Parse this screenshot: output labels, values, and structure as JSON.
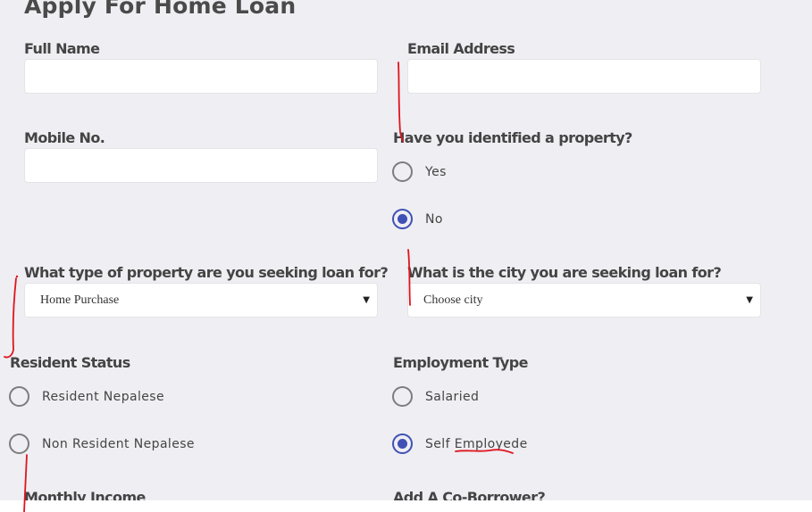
{
  "page": {
    "title": "Apply For Home Loan"
  },
  "form": {
    "full_name": {
      "label": "Full Name",
      "value": "",
      "placeholder": ""
    },
    "email": {
      "label": "Email Address",
      "value": "",
      "placeholder": ""
    },
    "mobile": {
      "label": "Mobile No.",
      "value": "",
      "placeholder": ""
    },
    "property_identified": {
      "label": "Have you identified a property?",
      "options": [
        {
          "label": "Yes",
          "checked": false
        },
        {
          "label": "No",
          "checked": true
        }
      ]
    },
    "property_type": {
      "label": "What type of property are you seeking loan for?",
      "selected": "Home Purchase"
    },
    "city": {
      "label": "What is the city you are seeking loan for?",
      "selected": "Choose city"
    },
    "resident_status": {
      "label": "Resident Status",
      "options": [
        {
          "label": "Resident Nepalese",
          "checked": false
        },
        {
          "label": "Non Resident Nepalese",
          "checked": false
        }
      ]
    },
    "employment_type": {
      "label": "Employment Type",
      "options": [
        {
          "label": "Salaried",
          "checked": false
        },
        {
          "label": "Self Employede",
          "checked": true
        }
      ]
    },
    "monthly_income": {
      "label": "Monthly Income"
    },
    "co_borrower": {
      "label": "Add A Co-Borrower?"
    }
  },
  "colors": {
    "accent": "#3f51b5",
    "annotation": "#e0141e",
    "background": "#efeef3"
  }
}
